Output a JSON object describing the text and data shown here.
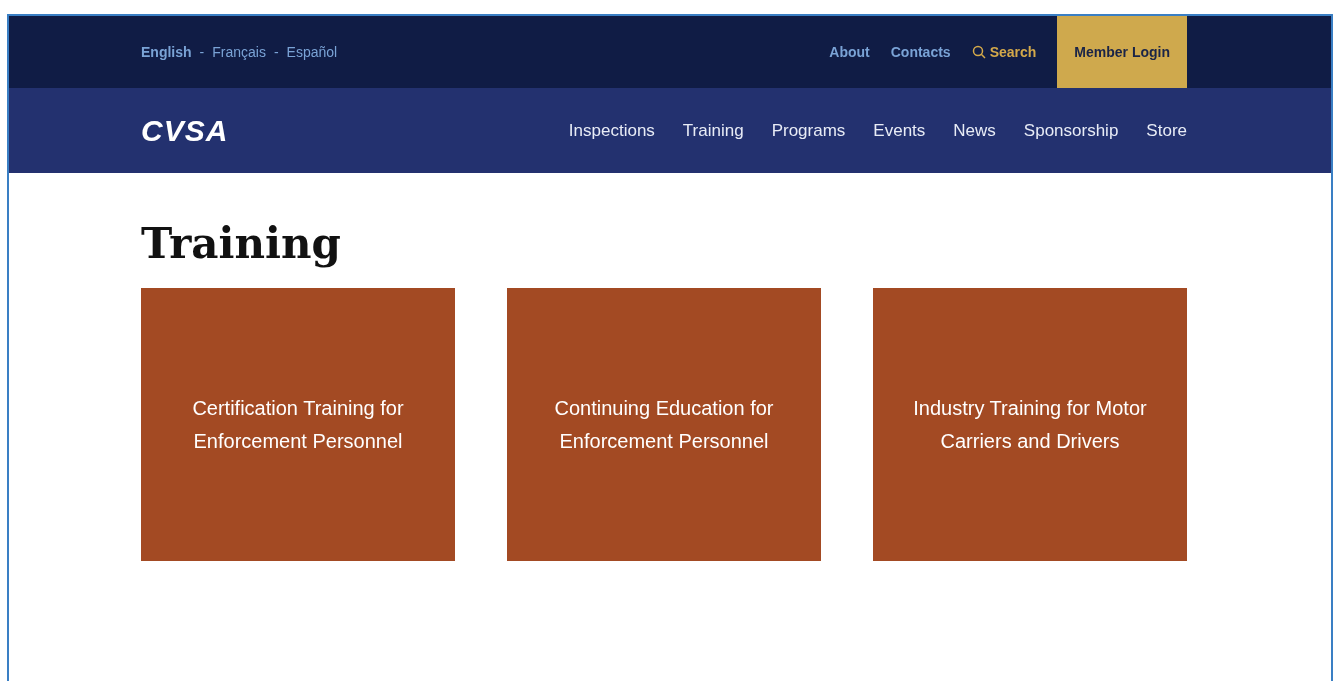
{
  "languages": [
    {
      "label": "English",
      "selected": true
    },
    {
      "label": "Français",
      "selected": false
    },
    {
      "label": "Español",
      "selected": false
    }
  ],
  "language_separator": "-",
  "utility_links": [
    "About",
    "Contacts"
  ],
  "search": {
    "label": "Search"
  },
  "member_login": "Member Login",
  "logo": "CVSA",
  "nav": [
    "Inspections",
    "Training",
    "Programs",
    "Events",
    "News",
    "Sponsorship",
    "Store"
  ],
  "heading": "Training",
  "cards": [
    {
      "title": "Certification Training for Enforcement Personnel"
    },
    {
      "title": "Continuing Education for Enforcement Personnel"
    },
    {
      "title": "Industry Training for Motor Carriers and Drivers"
    }
  ]
}
